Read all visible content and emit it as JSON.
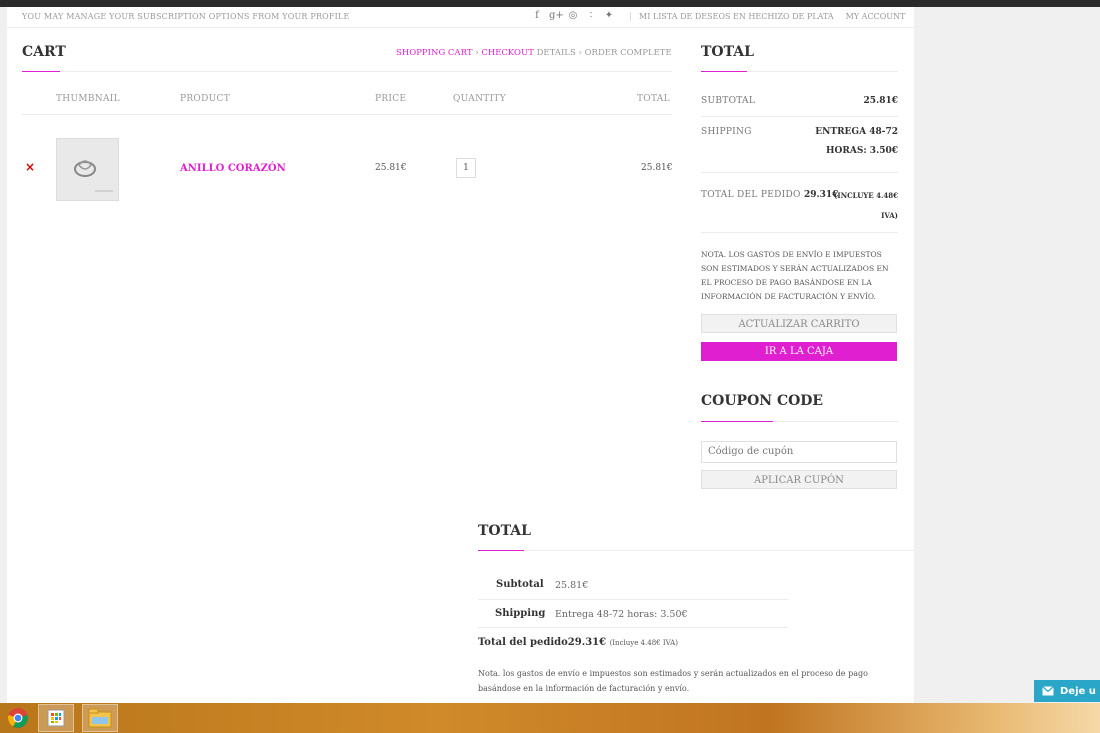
{
  "header": {
    "notice": "YOU MAY MANAGE YOUR SUBSCRIPTION OPTIONS FROM YOUR PROFILE",
    "social": [
      {
        "name": "facebook-icon",
        "glyph": "f"
      },
      {
        "name": "google-plus-icon",
        "glyph": "g+"
      },
      {
        "name": "pinterest-icon",
        "glyph": "◎"
      },
      {
        "name": "rss-icon",
        "glyph": "∶"
      },
      {
        "name": "twitter-icon",
        "glyph": "✦"
      }
    ],
    "wishlist_link": "MI LISTA DE DESEOS EN HECHIZO DE PLATA",
    "account_link": "MY ACCOUNT"
  },
  "cart": {
    "title": "CART",
    "breadcrumb": {
      "step1": "SHOPPING CART",
      "sep1": " › ",
      "step2a": "CHECKOUT",
      "step2b": " DETAILS",
      "sep2": " › ",
      "step3": "ORDER COMPLETE"
    },
    "columns": {
      "thumbnail": "THUMBNAIL",
      "product": "PRODUCT",
      "price": "PRICE",
      "quantity": "QUANTITY",
      "total": "TOTAL"
    },
    "items": [
      {
        "remove": "×",
        "name": "ANILLO CORAZÓN",
        "price": "25.81€",
        "quantity": "1",
        "total": "25.81€"
      }
    ]
  },
  "sidebar": {
    "total_title": "TOTAL",
    "subtotal_label": "SUBTOTAL",
    "subtotal_value": "25.81€",
    "shipping_label": "SHIPPING",
    "shipping_value_line1": "ENTREGA 48-72",
    "shipping_value_line2": "HORAS: 3.50€",
    "order_total_label": "TOTAL DEL PEDIDO",
    "order_total_value": "29.31€",
    "order_total_tax_line1": "(INCLUYE 4.48€",
    "order_total_tax_line2": "IVA)",
    "note": "NOTA. LOS GASTOS DE ENVÍO E IMPUESTOS SON ESTIMADOS Y SERÁN ACTUALIZADOS EN EL PROCESO DE PAGO BASÁNDOSE EN LA INFORMACIÓN DE FACTURACIÓN Y ENVÍO.",
    "update_button": "ACTUALIZAR CARRITO",
    "checkout_button": "IR A LA CAJA",
    "coupon_title": "COUPON CODE",
    "coupon_placeholder": "Código de cupón",
    "apply_coupon_button": "APLICAR CUPÓN"
  },
  "totals_bottom": {
    "title": "TOTAL",
    "subtotal_label": "Subtotal",
    "subtotal_value": "25.81€",
    "shipping_label": "Shipping",
    "shipping_value": "Entrega 48-72 horas: 3.50€",
    "order_total_label": "Total del pedido",
    "order_total_value": "29.31€",
    "order_total_tax": "(Incluye 4.48€ IVA)",
    "note": "Nota. los gastos de envío e impuestos son estimados y serán actualizados en el proceso de pago basándose en la información de facturación y envío."
  },
  "chat_widget": {
    "label": "Deje u"
  },
  "colors": {
    "accent": "#e020d0",
    "remove": "#dd0000",
    "chat": "#2aa7c8"
  }
}
